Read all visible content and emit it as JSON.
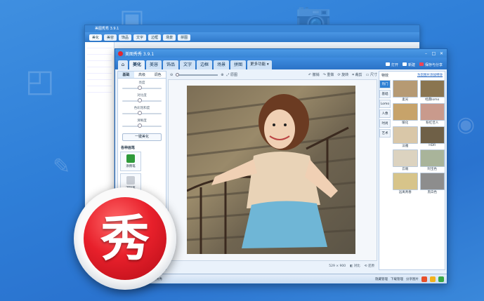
{
  "app_title": "美图秀秀 3.9.1",
  "nav_tabs": [
    "美化",
    "美容",
    "饰品",
    "文字",
    "边框",
    "场景",
    "拼图"
  ],
  "nav_more": "更多功能",
  "actions": {
    "open": "打开",
    "new": "新建",
    "save": "保存与分享"
  },
  "left_subtabs": [
    "基础",
    "高级",
    "调色"
  ],
  "sliders": [
    "亮度",
    "对比度",
    "色彩饱和度",
    "清晰度"
  ],
  "auto_beautify": "一键美化",
  "brush_section": "各种画笔",
  "brushes": [
    {
      "label": "涂鸦笔",
      "color": "#2f9a3a"
    },
    {
      "label": "消除笔",
      "color": "#c9ced6"
    }
  ],
  "toolbar": {
    "rotate": "旋转",
    "crop": "裁剪",
    "resize": "尺寸",
    "undo": "撤销",
    "redo": "重做",
    "original": "原图",
    "compare": "对比"
  },
  "status": {
    "size": "529 × 900",
    "contrast": "对比",
    "reset": "还原"
  },
  "effects_title": "特效",
  "effects_link": "为您图片添加特效",
  "effect_categories": [
    "热门",
    "基础",
    "Lomo",
    "人像",
    "时尚",
    "艺术"
  ],
  "effects": [
    {
      "label": "柔光",
      "color": "#b69a73"
    },
    {
      "label": "经典lomo",
      "color": "#8a7550"
    },
    {
      "label": "暖化",
      "color": "#c7a36a"
    },
    {
      "label": "粉红佳人",
      "color": "#c99a8c"
    },
    {
      "label": "淡雅",
      "color": "#d9c7a8"
    },
    {
      "label": "HDR",
      "color": "#6f6047"
    },
    {
      "label": "云端",
      "color": "#dcd3c0"
    },
    {
      "label": "阿宝色",
      "color": "#a9b49a"
    },
    {
      "label": "远离青春",
      "color": "#d7c48a"
    },
    {
      "label": "黑白色",
      "color": "#8d8d8d"
    }
  ],
  "bottom": {
    "tip": "我是美图秀秀",
    "hide": "隐藏管理",
    "download": "下载管理",
    "share": "分享图片"
  },
  "big_logo_char": "秀",
  "colors": {
    "accent": "#2e7fd3",
    "logo_red": "#e8202b",
    "background": "#3384da"
  }
}
